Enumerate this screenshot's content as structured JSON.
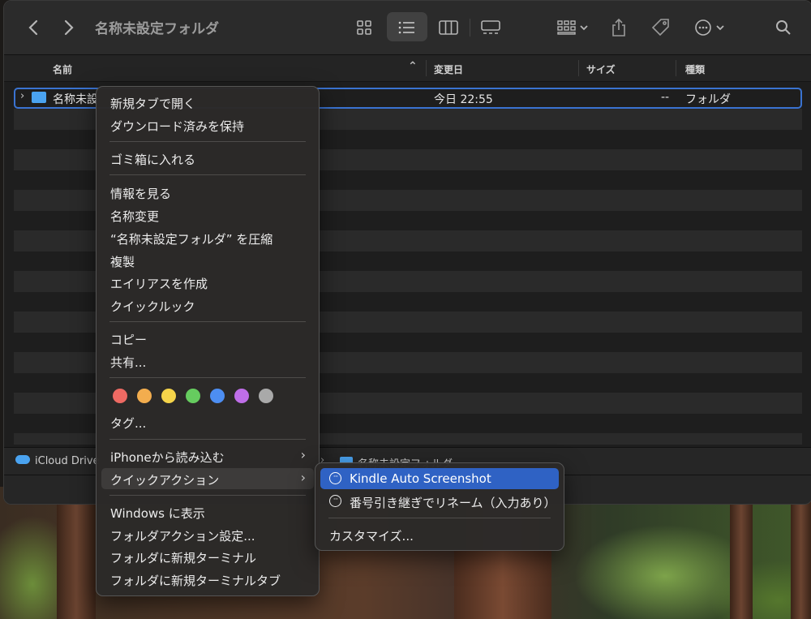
{
  "window": {
    "title": "名称未設定フォルダ"
  },
  "columns": {
    "name": "名前",
    "modified": "変更日",
    "size": "サイズ",
    "kind": "種類"
  },
  "file_row": {
    "name": "名称未設",
    "modified": "今日 22:55",
    "size": "--",
    "kind": "フォルダ"
  },
  "pathbar": {
    "root": "iCloud Drive",
    "folder": "名称未設定フォルダ"
  },
  "context_menu": {
    "open_new_tab": "新規タブで開く",
    "keep_downloaded": "ダウンロード済みを保持",
    "move_to_trash": "ゴミ箱に入れる",
    "get_info": "情報を見る",
    "rename": "名称変更",
    "compress": "“名称未設定フォルダ” を圧縮",
    "duplicate": "複製",
    "make_alias": "エイリアスを作成",
    "quick_look": "クイックルック",
    "copy": "コピー",
    "share": "共有...",
    "tags": "タグ...",
    "import_from_iphone": "iPhoneから読み込む",
    "quick_actions": "クイックアクション",
    "show_in_windows": "Windows に表示",
    "folder_actions_setup": "フォルダアクション設定...",
    "new_terminal_at_folder": "フォルダに新規ターミナル",
    "new_terminal_tab_at_folder": "フォルダに新規ターミナルタブ"
  },
  "tag_colors": [
    "#ee6a63",
    "#f3ad4e",
    "#f5d44a",
    "#66cc5f",
    "#4d8ef2",
    "#bf6ee8",
    "#a9a9a9"
  ],
  "submenu": {
    "kindle": "Kindle Auto Screenshot",
    "rename_sequential": "番号引き継ぎでリネーム（入力あり）",
    "customize": "カスタマイズ..."
  },
  "icons": {
    "back": "chevron-left-icon",
    "forward": "chevron-right-icon",
    "search": "search-icon"
  },
  "accent_color": "#2f62c4"
}
